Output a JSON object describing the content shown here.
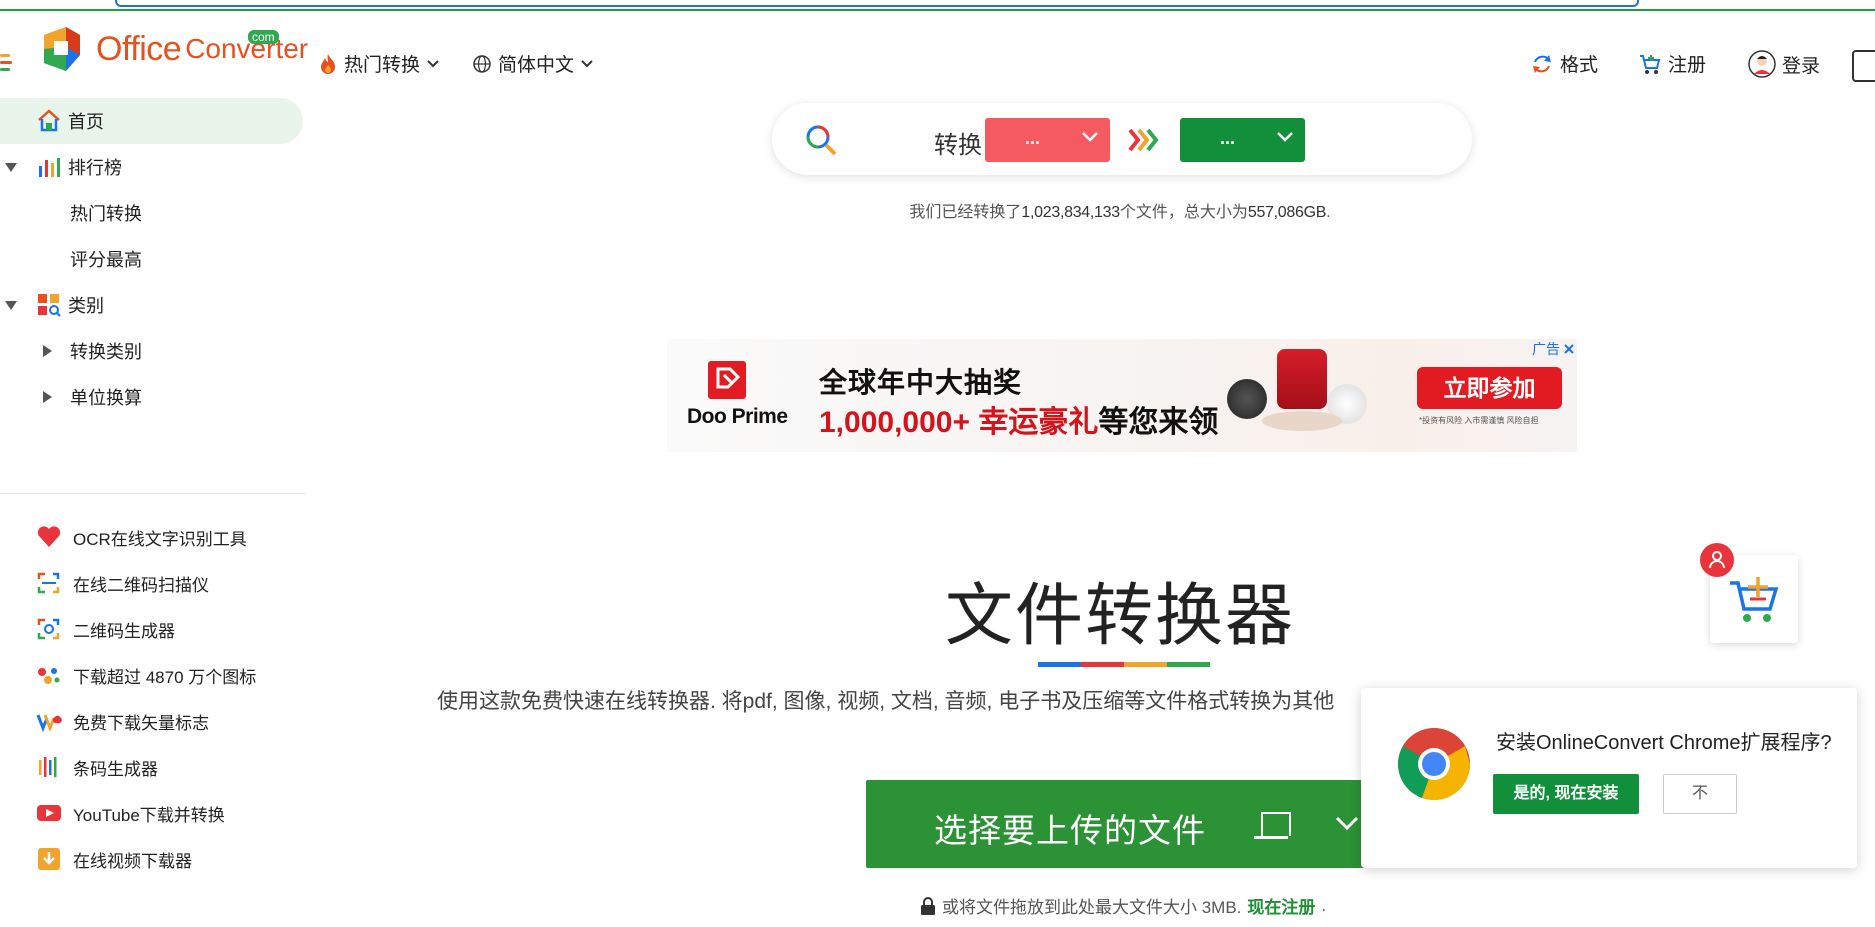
{
  "header": {
    "logo_main": "Office",
    "logo_sub": "Converter",
    "logo_badge": "com",
    "hot_label": "热门转换",
    "lang_label": "简体中文",
    "format_label": "格式",
    "register_label": "注册",
    "login_label": "登录"
  },
  "sidebar": {
    "home": "首页",
    "ranking": "排行榜",
    "hot": "热门转换",
    "top_rated": "评分最高",
    "category": "类别",
    "convert_category": "转换类别",
    "unit_convert": "单位换算",
    "tools": [
      {
        "label": "OCR在线文字识别工具"
      },
      {
        "label": "在线二维码扫描仪"
      },
      {
        "label": "二维码生成器"
      },
      {
        "label": "下载超过 4870 万个图标"
      },
      {
        "label": "免费下载矢量标志"
      },
      {
        "label": "条码生成器"
      },
      {
        "label": "YouTube下载并转换"
      },
      {
        "label": "在线视频下载器"
      }
    ]
  },
  "search": {
    "label": "转换",
    "from_value": "...",
    "to_value": "..."
  },
  "stats": {
    "prefix": "我们已经转换了",
    "files": "1,023,834,133",
    "middle": "个文件，总大小为",
    "size": "557,086GB",
    "suffix": "."
  },
  "ad": {
    "tag": "广告",
    "brand": "Doo Prime",
    "line1": "全球年中大抽奖",
    "line2_red": "1,000,000+ 幸运豪礼",
    "line2_black": "等您来领",
    "cta": "立即参加",
    "note": "*投资有风险 入市需谨慎 风险自担"
  },
  "main": {
    "title": "文件转换器",
    "description": "使用这款免费快速在线转换器. 将pdf, 图像, 视频, 文档, 音频, 电子书及压缩等文件格式转换为其他",
    "upload_label": "选择要上传的文件",
    "drop_note": "或将文件拖放到此处最大文件大小 3MB.",
    "register_now": "现在注册",
    "register_suffix": "."
  },
  "chrome_popup": {
    "message": "安装OnlineConvert Chrome扩展程序?",
    "yes": "是的, 现在安装",
    "no": "不"
  },
  "colors": {
    "accent_green": "#128f3a",
    "from_red": "#f55a60",
    "brand_orange": "#e8501e",
    "ad_red": "#e21a22"
  }
}
